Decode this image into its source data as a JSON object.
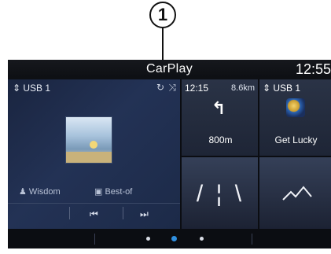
{
  "callout": {
    "number": "1"
  },
  "topbar": {
    "title": "CarPlay",
    "clock": "12:55"
  },
  "media": {
    "source": "⇕ USB 1",
    "controls": "↻ ⤨",
    "artist": "Wisdom",
    "album": "Best-of",
    "prev_icon": "⏮",
    "next_icon": "⏭"
  },
  "navigation": {
    "time": "12:15",
    "distance": "8.6km",
    "turn_icon": "↰",
    "next_maneuver": "800m"
  },
  "now_playing": {
    "source": "⇕ USB 1",
    "title": "Get Lucky"
  },
  "road_tile": {
    "icon": "/ ¦ \\"
  },
  "pager": {
    "pages": 3,
    "active": 1
  },
  "colors": {
    "accent": "#2f8fe0",
    "screen_bg": "#0b0d12",
    "media_tile": "#233255"
  }
}
